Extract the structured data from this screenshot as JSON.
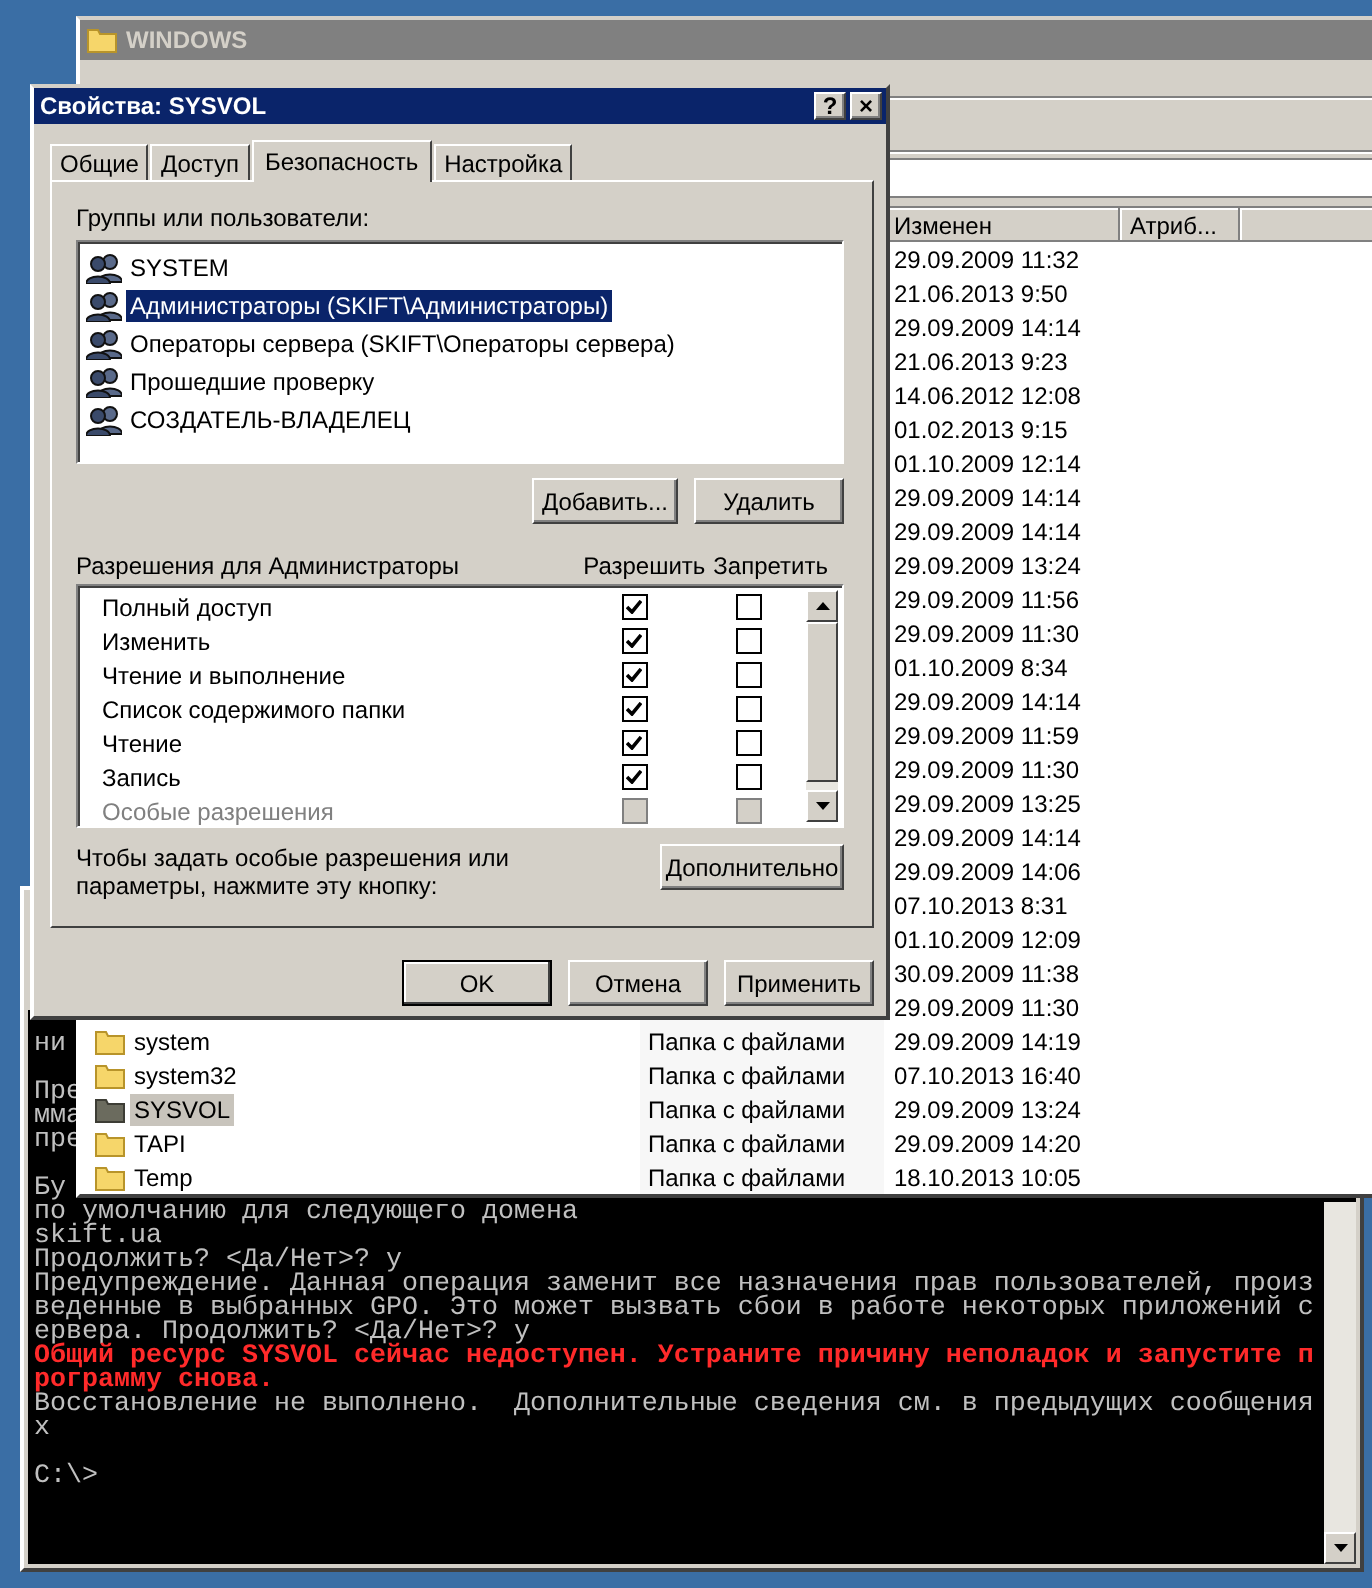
{
  "explorer": {
    "title": "WINDOWS",
    "columns": [
      {
        "label": "Изменен"
      },
      {
        "label": "Атриб..."
      }
    ],
    "rows": [
      {
        "modified": "29.09.2009 11:32",
        "selected": false
      },
      {
        "modified": "21.06.2013 9:50",
        "selected": false
      },
      {
        "modified": "29.09.2009 14:14",
        "selected": false
      },
      {
        "modified": "21.06.2013 9:23",
        "selected": false
      },
      {
        "modified": "14.06.2012 12:08",
        "selected": false
      },
      {
        "modified": "01.02.2013 9:15",
        "selected": false
      },
      {
        "modified": "01.10.2009 12:14",
        "selected": false
      },
      {
        "modified": "29.09.2009 14:14",
        "selected": false
      },
      {
        "modified": "29.09.2009 14:14",
        "selected": false
      },
      {
        "modified": "29.09.2009 13:24",
        "selected": false
      },
      {
        "modified": "29.09.2009 11:56",
        "selected": false
      },
      {
        "modified": "29.09.2009 11:30",
        "selected": false
      },
      {
        "modified": "01.10.2009 8:34",
        "selected": false
      },
      {
        "modified": "29.09.2009 14:14",
        "selected": false
      },
      {
        "modified": "29.09.2009 11:59",
        "selected": false
      },
      {
        "modified": "29.09.2009 11:30",
        "selected": false
      },
      {
        "modified": "29.09.2009 13:25",
        "selected": false
      },
      {
        "modified": "29.09.2009 14:14",
        "selected": false
      },
      {
        "modified": "29.09.2009 14:06",
        "selected": false
      },
      {
        "modified": "07.10.2013 8:31",
        "selected": false
      },
      {
        "modified": "01.10.2009 12:09",
        "selected": false
      },
      {
        "modified": "30.09.2009 11:38",
        "selected": false
      },
      {
        "modified": "29.09.2009 11:30",
        "selected": false
      },
      {
        "name": "system",
        "type": "Папка с файлами",
        "modified": "29.09.2009 14:19",
        "selected": false
      },
      {
        "name": "system32",
        "type": "Папка с файлами",
        "modified": "07.10.2013 16:40",
        "selected": false
      },
      {
        "name": "SYSVOL",
        "type": "Папка с файлами",
        "modified": "29.09.2009 13:24",
        "selected": true
      },
      {
        "name": "TAPI",
        "type": "Папка с файлами",
        "modified": "29.09.2009 14:20",
        "selected": false
      },
      {
        "name": "Temp",
        "type": "Папка с файлами",
        "modified": "18.10.2013 10:05",
        "selected": false
      }
    ]
  },
  "dialog": {
    "title": "Свойства: SYSVOL",
    "title_buttons": [
      "?",
      "×"
    ],
    "tabs": [
      {
        "label": "Общие",
        "selected": false
      },
      {
        "label": "Доступ",
        "selected": false
      },
      {
        "label": "Безопасность",
        "selected": true
      },
      {
        "label": "Настройка",
        "selected": false
      }
    ],
    "principals_label": "Группы или пользователи:",
    "principals": [
      {
        "name": "SYSTEM",
        "selected": false
      },
      {
        "name": "Администраторы (SKIFT\\Администраторы)",
        "selected": true
      },
      {
        "name": "Операторы сервера (SKIFT\\Операторы сервера)",
        "selected": false
      },
      {
        "name": "Прошедшие проверку",
        "selected": false
      },
      {
        "name": "СОЗДАТЕЛЬ-ВЛАДЕЛЕЦ",
        "selected": false
      }
    ],
    "principal_buttons": [
      "Добавить...",
      "Удалить"
    ],
    "permissions_label": "Разрешения для Администраторы",
    "allow_label": "Разрешить",
    "deny_label": "Запретить",
    "permissions": [
      {
        "name": "Полный доступ",
        "allow": true,
        "deny": false,
        "disabled": false
      },
      {
        "name": "Изменить",
        "allow": true,
        "deny": false,
        "disabled": false
      },
      {
        "name": "Чтение и выполнение",
        "allow": true,
        "deny": false,
        "disabled": false
      },
      {
        "name": "Список содержимого папки",
        "allow": true,
        "deny": false,
        "disabled": false
      },
      {
        "name": "Чтение",
        "allow": true,
        "deny": false,
        "disabled": false
      },
      {
        "name": "Запись",
        "allow": true,
        "deny": false,
        "disabled": false
      },
      {
        "name": "Особые разрешения",
        "allow": false,
        "deny": false,
        "disabled": true
      }
    ],
    "advanced_hint": "Чтобы задать особые разрешения или параметры, нажмите эту кнопку:",
    "advanced_button": "Дополнительно",
    "buttons": [
      "OK",
      "Отмена",
      "Применить"
    ]
  },
  "console": {
    "lines": [
      {
        "kind": "normal",
        "text": "ни"
      },
      {
        "kind": "blank"
      },
      {
        "kind": "normal",
        "text": "Пре"
      },
      {
        "kind": "normal",
        "text": "мма"
      },
      {
        "kind": "normal",
        "text": "пре"
      },
      {
        "kind": "blank"
      },
      {
        "kind": "normal",
        "text": "Бу"
      },
      {
        "kind": "normal",
        "text": "по умолчанию для следующего домена"
      },
      {
        "kind": "normal",
        "text": "skift.ua"
      },
      {
        "kind": "normal",
        "text": "Продолжить? <Да/Нет>? y"
      },
      {
        "kind": "normal",
        "text": "Предупреждение. Данная операция заменит все назначения прав пользователей, произ"
      },
      {
        "kind": "normal",
        "text": "веденные в выбранных GPO. Это может вызвать сбои в работе некоторых приложений с"
      },
      {
        "kind": "normal",
        "text": "ервера. Продолжить? <Да/Нет>? y"
      },
      {
        "kind": "error",
        "text": "Общий ресурс SYSVOL сейчас недоступен. Устраните причину неполадок и запустите п"
      },
      {
        "kind": "error",
        "text": "рограмму снова."
      },
      {
        "kind": "normal",
        "text": "Восстановление не выполнено.  Дополнительные сведения см. в предыдущих сообщения"
      },
      {
        "kind": "normal",
        "text": "х"
      },
      {
        "kind": "blank"
      },
      {
        "kind": "normal",
        "text": "C:\\>"
      }
    ]
  }
}
